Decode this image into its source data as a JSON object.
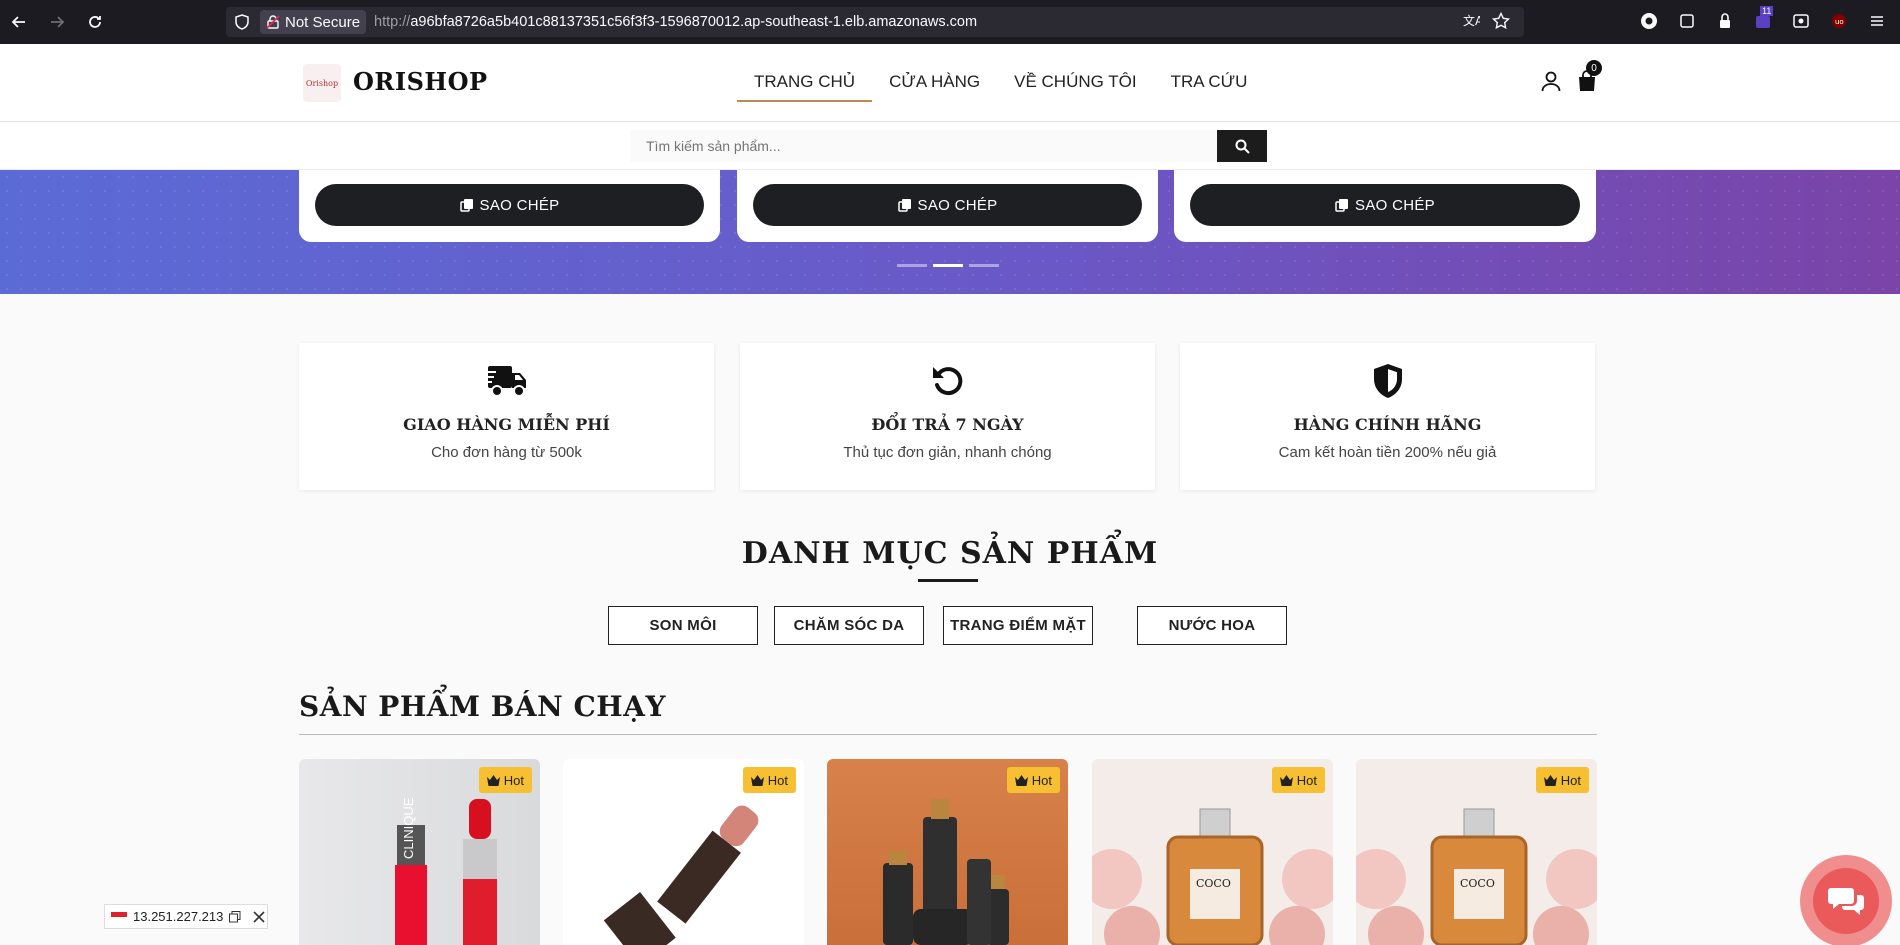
{
  "browser": {
    "security_label": "Not Secure",
    "url_prefix": "http://",
    "url_host": "a96bfa8726a5b401c88137351c56f3f3-1596870012.ap-southeast-1.elb.amazonaws.com",
    "extension_badge": "11"
  },
  "header": {
    "logo_text": "ORISHOP",
    "logo_mark": "Orishop",
    "nav": [
      "TRANG CHỦ",
      "CỬA HÀNG",
      "VỀ CHÚNG TÔI",
      "TRA CỨU"
    ],
    "cart_count": "0"
  },
  "search": {
    "placeholder": "Tìm kiếm sản phẩm..."
  },
  "hero": {
    "copy_label": "SAO CHÉP",
    "active_slide": 2
  },
  "features": [
    {
      "icon": "truck-icon",
      "title": "GIAO HÀNG MIỄN PHÍ",
      "desc": "Cho đơn hàng từ 500k"
    },
    {
      "icon": "undo-icon",
      "title": "ĐỔI TRẢ 7 NGÀY",
      "desc": "Thủ tục đơn giản, nhanh chóng"
    },
    {
      "icon": "shield-icon",
      "title": "HÀNG CHÍNH HÃNG",
      "desc": "Cam kết hoàn tiền 200% nếu giả"
    }
  ],
  "categories": {
    "title": "DANH MỤC SẢN PHẨM",
    "items": [
      "SON MÔI",
      "CHĂM SÓC DA",
      "TRANG ĐIỂM MẶT",
      "NƯỚC HOA"
    ]
  },
  "best_sellers": {
    "title": "SẢN PHẨM BÁN CHẠY",
    "badge": "Hot",
    "products": [
      {
        "image": "clinique-lipstick",
        "brand_text": "CLINIQUE"
      },
      {
        "image": "nude-lipstick"
      },
      {
        "image": "serum-bottles"
      },
      {
        "image": "coco-chanel-perfume",
        "brand_text": "COCO"
      },
      {
        "image": "coco-chanel-perfume",
        "brand_text": "COCO"
      }
    ]
  },
  "ip_overlay": {
    "ip": "13.251.227.213"
  },
  "colors": {
    "accent_underline": "#c08a4a",
    "hot_badge": "#f6c032",
    "hero_start": "#5b6bd6",
    "hero_end": "#7a44a8",
    "chat_button": "#ea5a5a"
  }
}
